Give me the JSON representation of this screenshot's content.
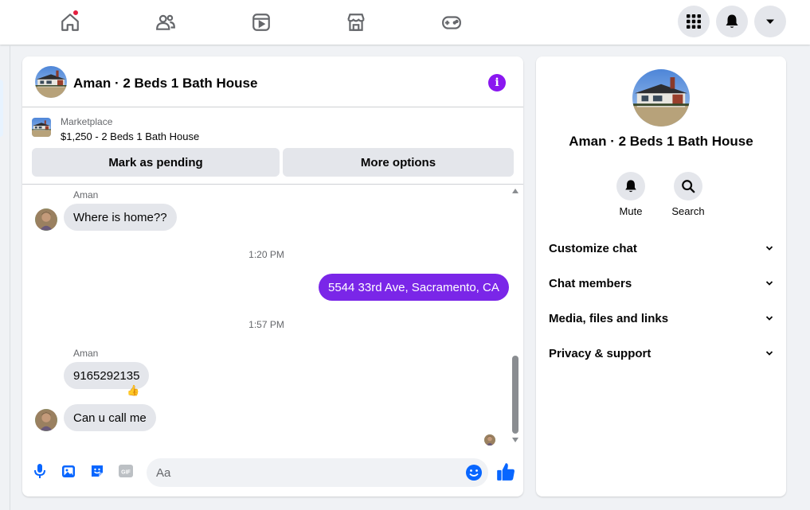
{
  "colors": {
    "accent": "#7a26e8",
    "facebook_blue": "#0866ff",
    "notification_dot": "#e41e3f",
    "info_purple": "#8a17f0"
  },
  "nav": {
    "icons": [
      "home-icon",
      "friends-icon",
      "video-icon",
      "marketplace-icon",
      "gaming-icon"
    ],
    "home_has_notification": true,
    "right_buttons": [
      "menu-grid-icon",
      "bell-icon",
      "account-caret-icon"
    ]
  },
  "chat": {
    "title": "Aman · 2 Beds 1 Bath House",
    "listing": {
      "source": "Marketplace",
      "price_title": "$1,250 - 2 Beds 1 Bath House"
    },
    "buttons": {
      "mark_pending": "Mark as pending",
      "more_options": "More options"
    },
    "messages": {
      "m1_sender": "Aman",
      "m1_text": "Where is home??",
      "t1": "1:20 PM",
      "m2_text": "5544 33rd Ave, Sacramento, CA",
      "t2": "1:57 PM",
      "m3_sender": "Aman",
      "m3_text": "9165292135",
      "m3_reaction": "👍",
      "m4_text": "Can u call me"
    },
    "composer": {
      "placeholder": "Aa",
      "icons": [
        "microphone-icon",
        "photo-icon",
        "sticker-icon",
        "gif-icon",
        "emoji-icon",
        "thumbs-up-icon"
      ]
    }
  },
  "side": {
    "title": "Aman · 2 Beds 1 Bath House",
    "actions": {
      "mute": "Mute",
      "search": "Search"
    },
    "sections": {
      "customize": "Customize chat",
      "members": "Chat members",
      "media": "Media, files and links",
      "privacy": "Privacy & support"
    }
  }
}
